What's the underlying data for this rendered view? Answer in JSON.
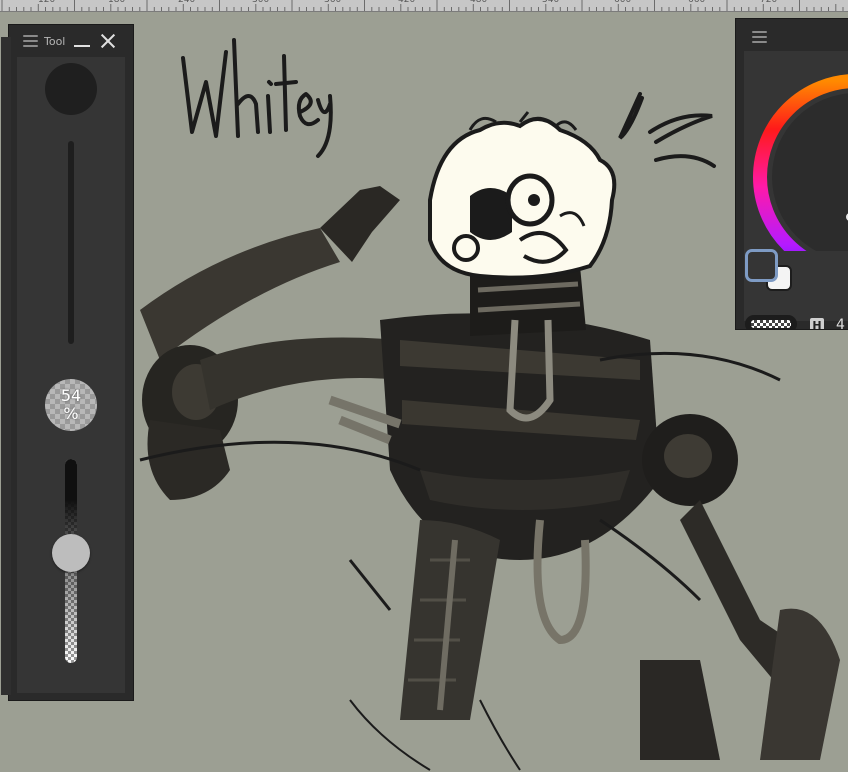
{
  "canvas": {
    "background_color": "#9c9f93",
    "handwritten_title": "Whitey"
  },
  "ruler": {
    "labels": [
      "120",
      "180",
      "240",
      "300",
      "360",
      "420",
      "480",
      "540",
      "600",
      "660",
      "720"
    ]
  },
  "tool_panel": {
    "title": "Tool",
    "opacity_value": "54",
    "opacity_unit": "%",
    "opacity_fraction": 0.54
  },
  "color_panel": {
    "foreground_color": "#353535",
    "background_color": "#f4f4f4",
    "mode_label": "H",
    "hue_value": "4"
  },
  "icons": {
    "menu": "hamburger-icon",
    "minimize": "minimize-icon",
    "close": "close-icon"
  }
}
